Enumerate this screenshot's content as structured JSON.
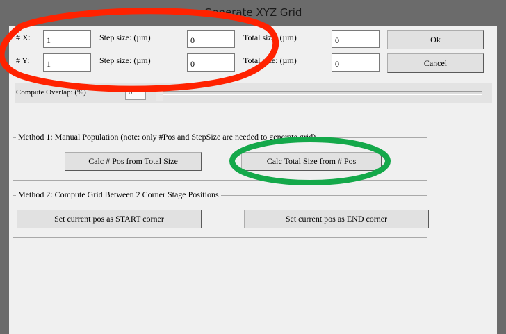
{
  "window": {
    "title": "Generate XYZ Grid"
  },
  "fields": {
    "x_label": "# X:",
    "x_value": "1",
    "x_step_label": "Step size: (µm)",
    "x_step_value": "0",
    "x_total_label": "Total size: (µm)",
    "x_total_value": "0",
    "y_label": "# Y:",
    "y_value": "1",
    "y_step_label": "Step size: (µm)",
    "y_step_value": "0",
    "y_total_label": "Total size: (µm)",
    "y_total_value": "0"
  },
  "buttons": {
    "ok_label": "Ok",
    "cancel_label": "Cancel"
  },
  "overlap": {
    "label": "Compute Overlap: (%)",
    "value": "0",
    "level": 0
  },
  "method1": {
    "legend": "Method 1: Manual Population (note: only #Pos and StepSize are needed to generate grid)",
    "calc_pos_label": "Calc # Pos from Total Size",
    "calc_size_label": "Calc Total Size from # Pos"
  },
  "method2": {
    "legend": "Method 2: Compute Grid Between 2 Corner Stage Positions",
    "start_label": "Set current pos as START corner",
    "end_label": "Set current pos as END corner"
  },
  "annotations": {
    "red_ellipse_color": "#ff2200",
    "green_ellipse_color": "#14a84a"
  }
}
